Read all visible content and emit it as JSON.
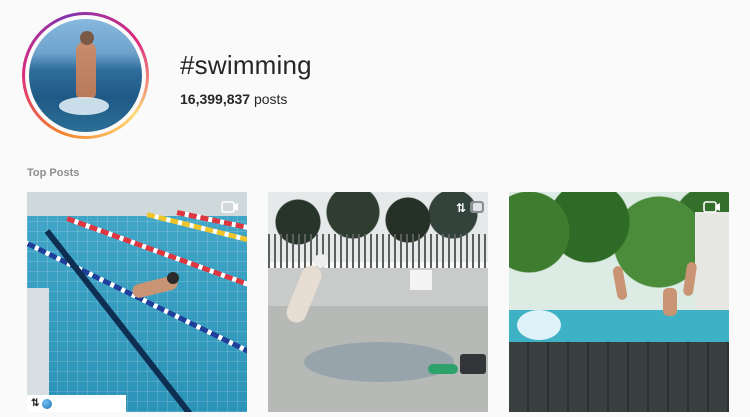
{
  "hashtag": {
    "title": "#swimming",
    "post_count": "16,399,837",
    "posts_label": "posts"
  },
  "section": {
    "top_posts_label": "Top Posts"
  },
  "posts": [
    {
      "id_label": "post-1",
      "badge": "video-icon",
      "attribution": "↓"
    },
    {
      "id_label": "post-2",
      "badge": "multi-photo-icon"
    },
    {
      "id_label": "post-3",
      "badge": "video-icon"
    }
  ],
  "colors": {
    "background": "#fafafa",
    "text": "#262626",
    "muted": "#8e8e8e",
    "ring_start": "#f58529",
    "ring_end": "#8134af"
  }
}
